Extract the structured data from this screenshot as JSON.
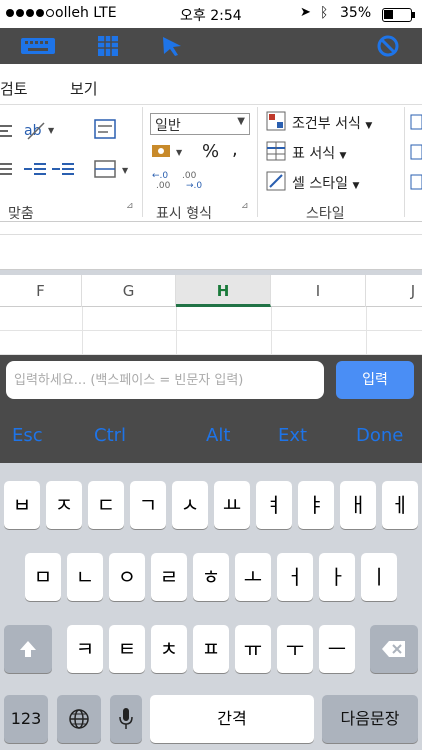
{
  "status": {
    "carrier": "olleh",
    "network": "LTE",
    "time": "오후 2:54",
    "battery": "35%"
  },
  "ribbon": {
    "tabs": [
      "검토",
      "보기"
    ],
    "number_format": "일반",
    "percent": "%",
    "comma": ",",
    "groups": {
      "alignment": "맞춤",
      "number": "표시 형식",
      "styles": "스타일"
    },
    "styles": {
      "conditional": "조건부 서식",
      "table": "표 서식",
      "cell": "셀 스타일"
    }
  },
  "sheet": {
    "columns": [
      "F",
      "G",
      "H",
      "I",
      "J"
    ],
    "selected": "H"
  },
  "input": {
    "placeholder": "입력하세요... (백스페이스 = 빈문자 입력)",
    "enter": "입력"
  },
  "keyrow": [
    "Esc",
    "Ctrl",
    "Alt",
    "Ext",
    "Done"
  ],
  "keyboard": {
    "row1": [
      "ㅂ",
      "ㅈ",
      "ㄷ",
      "ㄱ",
      "ㅅ",
      "ㅛ",
      "ㅕ",
      "ㅑ",
      "ㅐ",
      "ㅔ"
    ],
    "row2": [
      "ㅁ",
      "ㄴ",
      "ㅇ",
      "ㄹ",
      "ㅎ",
      "ㅗ",
      "ㅓ",
      "ㅏ",
      "ㅣ"
    ],
    "row3": [
      "ㅋ",
      "ㅌ",
      "ㅊ",
      "ㅍ",
      "ㅠ",
      "ㅜ",
      "ㅡ"
    ],
    "num": "123",
    "space": "간격",
    "return": "다음문장"
  }
}
